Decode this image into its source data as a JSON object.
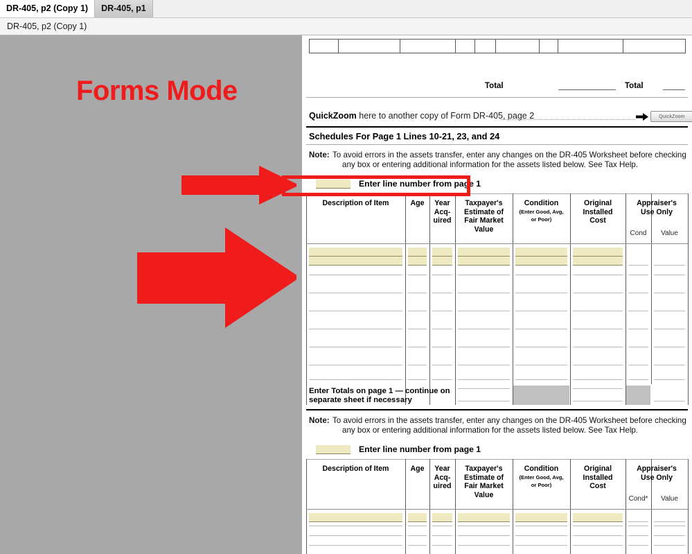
{
  "window": {
    "tabs": [
      {
        "label": "DR-405, p2 (Copy 1)",
        "active": true
      },
      {
        "label": "DR-405, p1",
        "active": false
      }
    ],
    "breadcrumb": "DR-405, p2 (Copy 1)"
  },
  "annotation": {
    "mode_label": "Forms Mode",
    "accent_color": "#f01b1b",
    "arrow_small_name": "red-arrow-right-small",
    "arrow_large_name": "red-arrow-right-large",
    "highlight_target": "Enter line number from page 1"
  },
  "form": {
    "top_table": {
      "total_label_1": "Total",
      "total_label_2": "Total"
    },
    "quickzoom": {
      "bold_word": "QuickZoom",
      "text": " here to another copy of Form DR-405, page 2",
      "button_label": "QuickZoom",
      "arrow_icon": "arrow-right-icon"
    },
    "schedules_title": "Schedules For Page 1 Lines 10-21, 23, and 24",
    "note": {
      "label": "Note:",
      "line1": "To avoid errors in the assets transfer, enter any changes on the DR-405 Worksheet before checking",
      "line2": "any box or entering additional information for the assets listed below. See Tax Help."
    },
    "enter_line_number": {
      "field_value": "",
      "label": "Enter line number from page 1"
    },
    "table_headers": {
      "description": "Description of Item",
      "age": "Age",
      "year_acquired": [
        "Year",
        "Acq-",
        "uired"
      ],
      "fmv": [
        "Taxpayer's",
        "Estimate of",
        "Fair Market",
        "Value"
      ],
      "condition_main": "Condition",
      "condition_sub": [
        "(Enter Good, Avg,",
        "or Poor)"
      ],
      "original_cost": [
        "Original",
        "Installed",
        "Cost"
      ],
      "appraiser": [
        "Appraiser's",
        "Use Only"
      ],
      "cond": "Cond",
      "cond_starred": "Cond*",
      "value": "Value"
    },
    "totals_row": {
      "line1": "Enter Totals on page 1 — continue on",
      "line2": "separate sheet if necessary"
    },
    "section_two": {
      "note": {
        "label": "Note:",
        "line1": "To avoid errors in the assets transfer, enter any changes on the DR-405 Worksheet before checking",
        "line2": "any box or entering additional information for the assets listed below. See Tax Help."
      },
      "enter_line_number": {
        "field_value": "",
        "label": "Enter line number from page 1"
      }
    }
  }
}
